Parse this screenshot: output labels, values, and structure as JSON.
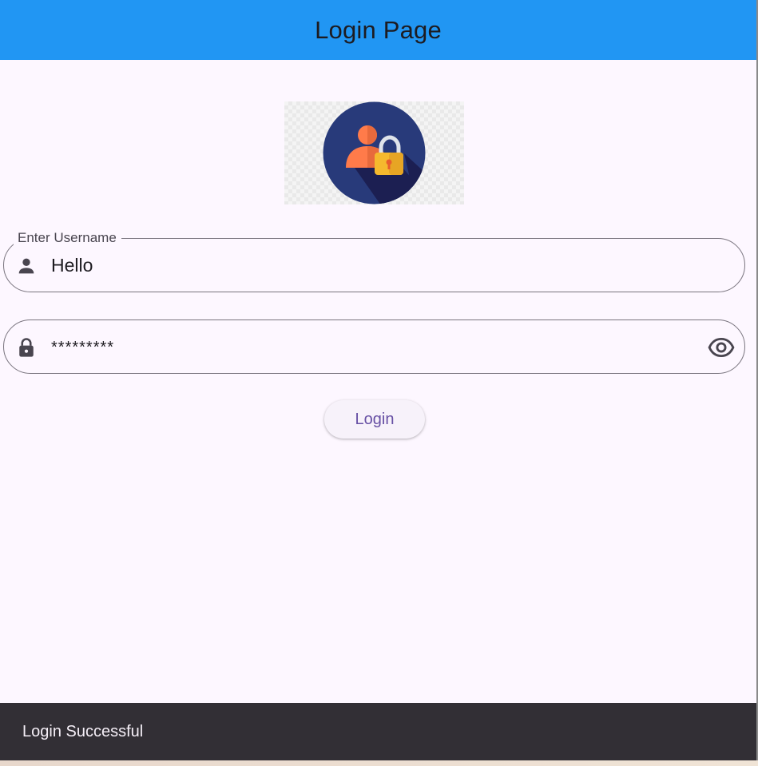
{
  "app_bar": {
    "title": "Login Page",
    "background_color": "#2196f3"
  },
  "logo": {
    "icon": "user-lock-icon",
    "circle_color": "#283a7a",
    "person_color": "#ff7b4a",
    "lock_color": "#f5b92e"
  },
  "username_field": {
    "label": "Enter Username",
    "value": "Hello",
    "icon": "person-icon"
  },
  "password_field": {
    "value": "*********",
    "icon": "lock-icon",
    "toggle_icon": "eye-icon"
  },
  "login_button": {
    "label": "Login",
    "text_color": "#6750a4"
  },
  "snackbar": {
    "message": "Login Successful"
  }
}
